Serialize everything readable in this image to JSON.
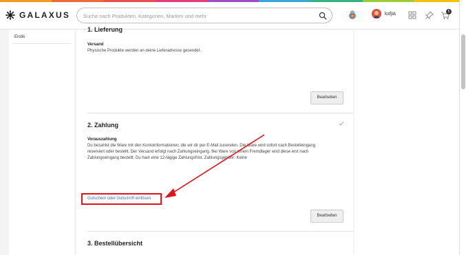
{
  "header": {
    "logo_text": "GALAXUS",
    "search_placeholder": "Suche nach Produkten, Kategorien, Marken und mehr",
    "username": "ksfjia",
    "cart_count": "5"
  },
  "sidebar": {
    "items": [
      {
        "label": "Erotik"
      }
    ]
  },
  "sections": {
    "delivery": {
      "title": "1. Lieferung",
      "subtitle": "Versand",
      "text": "Physische Produkte werden an deine Lieferadresse gesendet.",
      "button": "Bearbeiten"
    },
    "payment": {
      "title": "2. Zahlung",
      "subtitle": "Vorauszahlung",
      "text_lines": [
        "Du bezahlst die Ware mit den Kontoinformationen, die wir dir per E-Mail zusenden. Die Ware wird sofort nach Bestelleingang",
        "reserviert oder bestellt. Der Versand erfolgt nach Zahlungseingang. Bei Ware von einem Fremdlager wird diese erst nach",
        "Zahlungseingang bestellt. Du hast eine 12-tägige Zahlungsfrist. Zahlungsgebühr: Keine"
      ],
      "voucher_link": "Gutschein oder Gutschrift einlösen",
      "button": "Bearbeiten"
    },
    "summary": {
      "title": "3. Bestellübersicht"
    }
  },
  "colors": {
    "annotation": "#e0121b",
    "link": "#3a6fb7",
    "rainbow": [
      "#f29b1f",
      "#ef6a3a",
      "#e94f4f",
      "#e23d7a",
      "#9c4fc0",
      "#3aa7d6",
      "#36b37e",
      "#9ccc3c",
      "#f4c20d"
    ]
  }
}
